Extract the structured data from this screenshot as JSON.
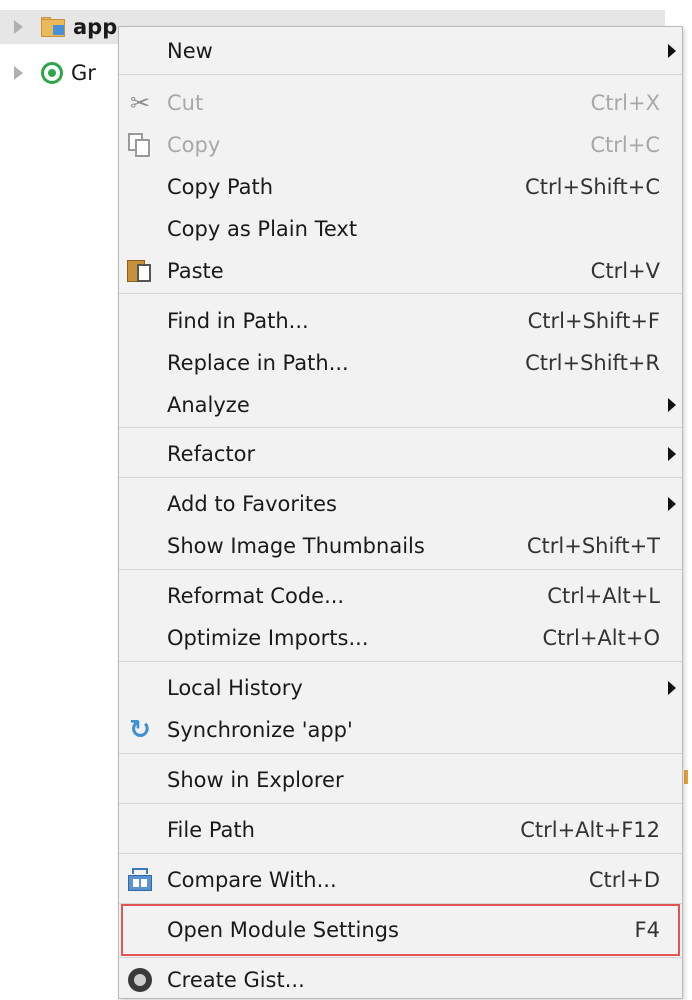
{
  "tree": {
    "row1_label": "app",
    "row2_label": "Gr"
  },
  "menu": {
    "items": [
      {
        "label": "New",
        "shortcut": "",
        "submenu": true
      },
      {
        "label": "Cut",
        "shortcut": "Ctrl+X",
        "disabled": true,
        "icon": "scissors-icon"
      },
      {
        "label": "Copy",
        "shortcut": "Ctrl+C",
        "disabled": true,
        "icon": "copy-icon"
      },
      {
        "label": "Copy Path",
        "shortcut": "Ctrl+Shift+C"
      },
      {
        "label": "Copy as Plain Text",
        "shortcut": ""
      },
      {
        "label": "Paste",
        "shortcut": "Ctrl+V",
        "icon": "paste-icon"
      },
      {
        "label": "Find in Path...",
        "shortcut": "Ctrl+Shift+F"
      },
      {
        "label": "Replace in Path...",
        "shortcut": "Ctrl+Shift+R"
      },
      {
        "label": "Analyze",
        "shortcut": "",
        "submenu": true
      },
      {
        "label": "Refactor",
        "shortcut": "",
        "submenu": true
      },
      {
        "label": "Add to Favorites",
        "shortcut": "",
        "submenu": true
      },
      {
        "label": "Show Image Thumbnails",
        "shortcut": "Ctrl+Shift+T"
      },
      {
        "label": "Reformat Code...",
        "shortcut": "Ctrl+Alt+L"
      },
      {
        "label": "Optimize Imports...",
        "shortcut": "Ctrl+Alt+O"
      },
      {
        "label": "Local History",
        "shortcut": "",
        "submenu": true
      },
      {
        "label": "Synchronize 'app'",
        "shortcut": "",
        "icon": "sync-icon"
      },
      {
        "label": "Show in Explorer",
        "shortcut": ""
      },
      {
        "label": "File Path",
        "shortcut": "Ctrl+Alt+F12"
      },
      {
        "label": "Compare With...",
        "shortcut": "Ctrl+D",
        "icon": "compare-icon"
      },
      {
        "label": "Open Module Settings",
        "shortcut": "F4",
        "highlighted": true
      },
      {
        "label": "Create Gist...",
        "shortcut": "",
        "icon": "github-gist-icon"
      }
    ]
  },
  "colors": {
    "menu_bg": "#f2f2f2",
    "highlight_border": "#e05555",
    "disabled_text": "#a8a8a8"
  }
}
